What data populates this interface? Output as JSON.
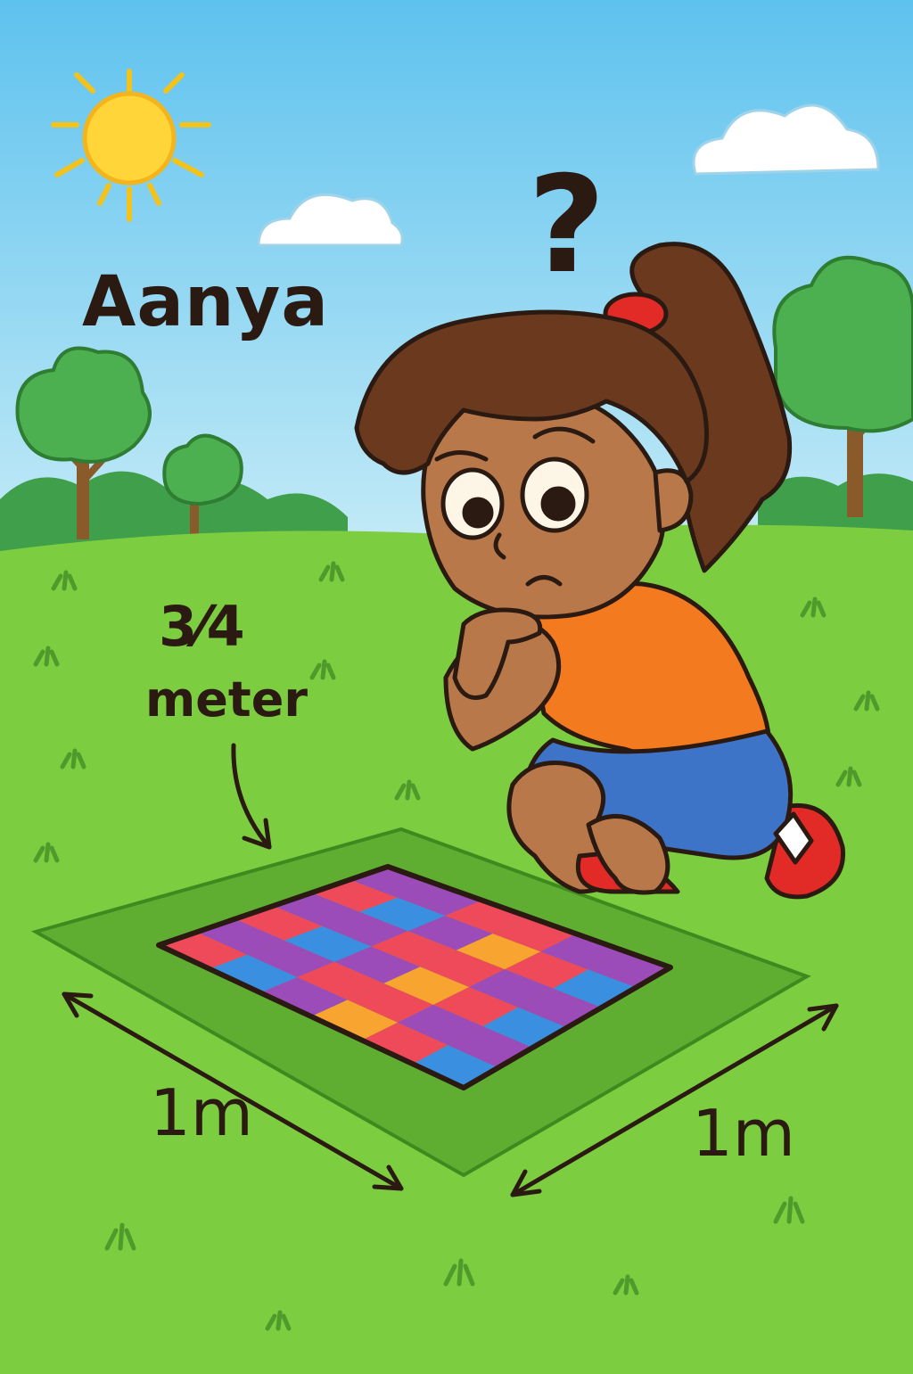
{
  "character": {
    "name": "Aanya"
  },
  "annotations": {
    "fraction": "3⁄4",
    "unit": "meter",
    "left_dimension": "1m",
    "right_dimension": "1m",
    "question_mark": "?"
  },
  "colors": {
    "sky_top": "#5ec2ee",
    "sky_bottom": "#c7ecf7",
    "grass": "#7ccd40",
    "border_patch": "#5fae32",
    "tile_red": "#ee4a5a",
    "tile_orange": "#f7a431",
    "tile_blue": "#3a8fe0",
    "tile_purple": "#9b4cb8",
    "shirt": "#f47a1f",
    "shorts": "#3d74c8",
    "shoes": "#e22a27",
    "skin": "#b9784a",
    "hair": "#6b3a1e",
    "sun": "#ffd53a"
  },
  "icons": [
    "sun-icon",
    "cloud-icon",
    "tree-icon",
    "arrow-icon",
    "question-mark-icon"
  ]
}
